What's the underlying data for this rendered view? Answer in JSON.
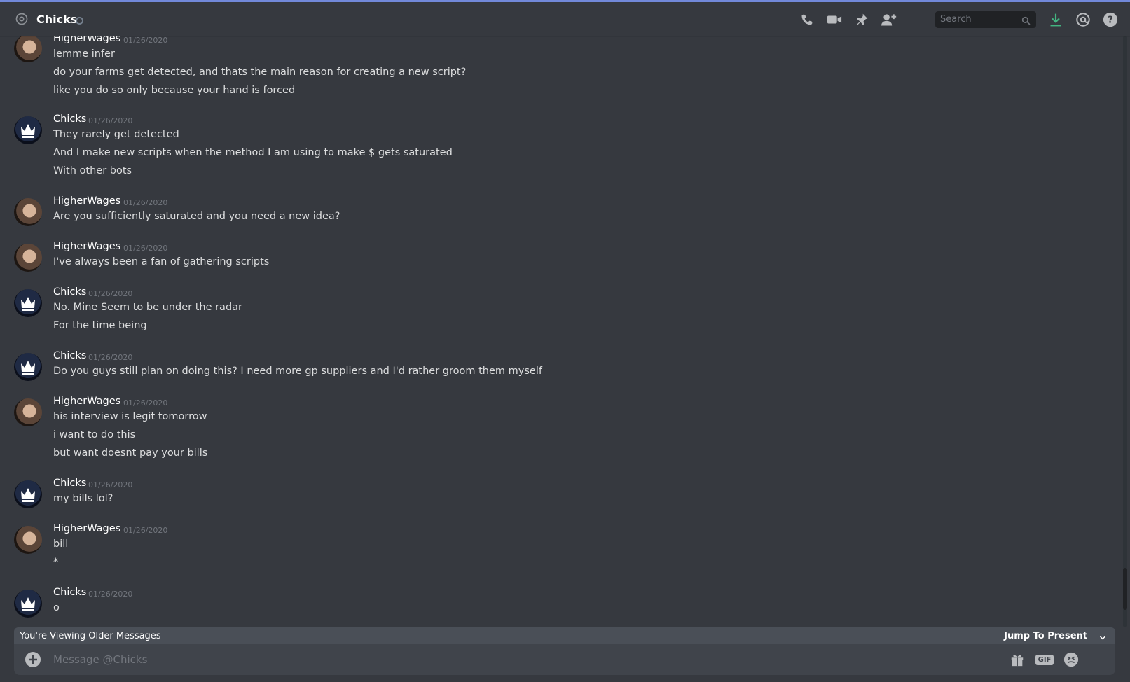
{
  "header": {
    "title": "Chicks",
    "search_placeholder": "Search",
    "icons": [
      "call-icon",
      "video-icon",
      "pin-icon",
      "add-friend-icon",
      "search-icon",
      "download-icon",
      "mention-icon",
      "help-icon"
    ]
  },
  "messages": [
    {
      "author": "HigherWages",
      "timestamp": "01/26/2020",
      "lines": [
        "lemme infer",
        "do your farms get detected, and thats the main reason for creating a new script?",
        "like you do so only because your hand is forced"
      ]
    },
    {
      "author": "Chicks",
      "timestamp": "01/26/2020",
      "lines": [
        "They rarely get detected",
        "And I make new scripts when the method I am using to make $ gets saturated",
        "With other bots"
      ]
    },
    {
      "author": "HigherWages",
      "timestamp": "01/26/2020",
      "lines": [
        "Are you sufficiently saturated and you need a new idea?"
      ]
    },
    {
      "author": "HigherWages",
      "timestamp": "01/26/2020",
      "lines": [
        "I've always been a fan of gathering scripts"
      ]
    },
    {
      "author": "Chicks",
      "timestamp": "01/26/2020",
      "lines": [
        "No. Mine Seem to be under the radar",
        "For the time being"
      ]
    },
    {
      "author": "Chicks",
      "timestamp": "01/26/2020",
      "lines": [
        "Do you guys still plan on doing this? I need more gp suppliers and I'd rather groom them myself"
      ]
    },
    {
      "author": "HigherWages",
      "timestamp": "01/26/2020",
      "lines": [
        "his interview is legit tomorrow",
        "i want to do this",
        "but want doesnt pay your bills"
      ]
    },
    {
      "author": "Chicks",
      "timestamp": "01/26/2020",
      "lines": [
        "my bills lol?"
      ]
    },
    {
      "author": "HigherWages",
      "timestamp": "01/26/2020",
      "lines": [
        "bill",
        "*"
      ]
    },
    {
      "author": "Chicks",
      "timestamp": "01/26/2020",
      "lines": [
        "o"
      ]
    }
  ],
  "older_bar": {
    "text": "You're Viewing Older Messages",
    "jump_label": "Jump To Present"
  },
  "composer": {
    "placeholder": "Message @Chicks",
    "gif_label": "GIF"
  },
  "colors": {
    "background": "#36393f",
    "header_accent": "#7289da",
    "download_green": "#43b581",
    "status_offline": "#747f8d"
  }
}
